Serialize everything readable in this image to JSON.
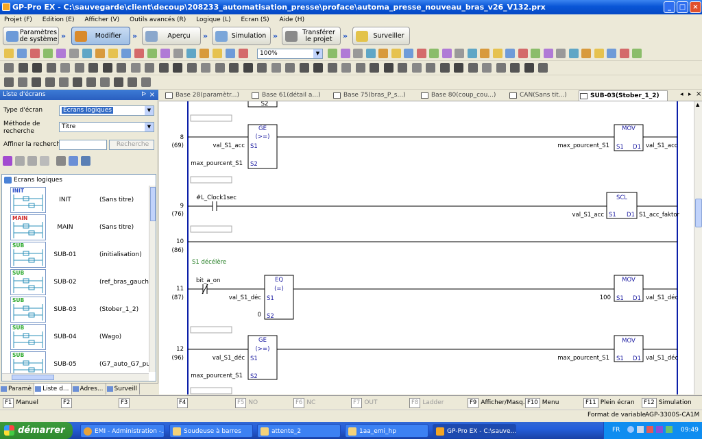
{
  "window": {
    "title": "GP-Pro EX - C:\\sauvegarde\\client\\decoup\\208233_automatisation_presse\\proface\\automa_presse_nouveau_bras_v26_V132.prx"
  },
  "menu": [
    "Projet (F)",
    "Edition (E)",
    "Afficher (V)",
    "Outils avancés (R)",
    "Logique (L)",
    "Ecran (S)",
    "Aide (H)"
  ],
  "workflow": [
    {
      "label": "Paramètres de système",
      "line1": "Paramètres",
      "line2": "de système"
    },
    {
      "label": "Modifier",
      "line1": "Modifier",
      "line2": ""
    },
    {
      "label": "Aperçu",
      "line1": "Aperçu",
      "line2": ""
    },
    {
      "label": "Simulation",
      "line1": "Simulation",
      "line2": ""
    },
    {
      "label": "Transférer le projet",
      "line1": "Transférer",
      "line2": "le projet"
    },
    {
      "label": "Surveiller",
      "line1": "Surveiller",
      "line2": ""
    }
  ],
  "toolbar": {
    "zoom": "100%"
  },
  "leftpanel": {
    "title": "Liste d'écrans",
    "screen_type_label": "Type d'écran",
    "screen_type_value": "Ecrans logiques",
    "search_method_label": "Méthode de recherche",
    "search_method_value": "Titre",
    "refine_label": "Affiner la recherche",
    "search_button": "Recherche",
    "tree_root": "Ecrans logiques",
    "screens": [
      {
        "tag": "INIT",
        "name": "INIT",
        "title": "(Sans titre)"
      },
      {
        "tag": "MAIN",
        "name": "MAIN",
        "title": "(Sans titre)"
      },
      {
        "tag": "SUB",
        "name": "SUB-01",
        "title": "(initialisation)"
      },
      {
        "tag": "SUB",
        "name": "SUB-02",
        "title": "(ref_bras_gauche_"
      },
      {
        "tag": "SUB",
        "name": "SUB-03",
        "title": "(Stober_1_2)"
      },
      {
        "tag": "SUB",
        "name": "SUB-04",
        "title": "(Wago)"
      },
      {
        "tag": "SUB",
        "name": "SUB-05",
        "title": "(G7_auto_G7_pu"
      }
    ],
    "tabs": [
      "Paramè",
      "Liste d...",
      "Adres...",
      "Surveill"
    ]
  },
  "editor_tabs": [
    {
      "label": "Base 28(paramètr...)",
      "active": false
    },
    {
      "label": "Base 61(détail a...)",
      "active": false
    },
    {
      "label": "Base 75(bras_P_s...)",
      "active": false
    },
    {
      "label": "Base 80(coup_cou...)",
      "active": false
    },
    {
      "label": "CAN(Sans tit...)",
      "active": false
    },
    {
      "label": "SUB-03(Stober_1_2)",
      "active": true
    }
  ],
  "ladder": {
    "top_partial": "S2",
    "rungs": [
      {
        "num": "8",
        "addr": "(69)"
      },
      {
        "num": "9",
        "addr": "(76)"
      },
      {
        "num": "10",
        "addr": "(86)"
      },
      {
        "num": "11",
        "addr": "(87)"
      },
      {
        "num": "12",
        "addr": "(96)"
      }
    ],
    "comment_s1": "S1 décélère",
    "r8": {
      "ge_title": "GE",
      "ge_op": "(>=)",
      "in1": "val_S1_acc",
      "in2": "max_pourcent_S1",
      "s1": "S1",
      "s2": "S2",
      "mov": "MOV",
      "mov_in": "max_pourcent_S1",
      "mov_out": "val_S1_acc",
      "d1": "D1"
    },
    "r9": {
      "contact": "#L_Clock1sec",
      "scl": "SCL",
      "scl_in": "val_S1_acc",
      "scl_out": "S1_acc_faktor",
      "s1": "S1",
      "d1": "D1"
    },
    "r11": {
      "contact": "bit_a_on",
      "eq_title": "EQ",
      "eq_op": "(=)",
      "in1": "val_S1_déc",
      "in2": "0",
      "s1": "S1",
      "s2": "S2",
      "mov": "MOV",
      "mov_in": "100",
      "mov_out": "val_S1_déc",
      "d1": "D1"
    },
    "r12": {
      "ge_title": "GE",
      "ge_op": "(>=)",
      "in1": "val_S1_déc",
      "in2": "max_pourcent_S1",
      "s1": "S1",
      "s2": "S2",
      "mov": "MOV",
      "mov_in": "max_pourcent_S1",
      "mov_out": "val_S1_déc",
      "d1": "D1"
    }
  },
  "fkeys": [
    {
      "key": "F1",
      "label": "Manuel",
      "enabled": true
    },
    {
      "key": "F2",
      "label": "",
      "enabled": true
    },
    {
      "key": "F3",
      "label": "",
      "enabled": true
    },
    {
      "key": "F4",
      "label": "",
      "enabled": true
    },
    {
      "key": "F5",
      "label": "NO",
      "enabled": false
    },
    {
      "key": "F6",
      "label": "NC",
      "enabled": false
    },
    {
      "key": "F7",
      "label": "OUT",
      "enabled": false
    },
    {
      "key": "F8",
      "label": "Ladder",
      "enabled": false
    },
    {
      "key": "F9",
      "label": "Afficher/Masq...",
      "enabled": true
    },
    {
      "key": "F10",
      "label": "Menu",
      "enabled": true
    },
    {
      "key": "F11",
      "label": "Plein écran",
      "enabled": true
    },
    {
      "key": "F12",
      "label": "Simulation",
      "enabled": true
    }
  ],
  "status": {
    "format": "Format de variable",
    "device": "AGP-3300S-CA1M"
  },
  "taskbar": {
    "start": "démarrer",
    "tasks": [
      "EMI - Administration -...",
      "Soudeuse à barres",
      "attente_2",
      "1aa_emi_hp",
      "GP-Pro EX - C:\\sauve..."
    ],
    "lang": "FR",
    "clock": "09:49"
  }
}
